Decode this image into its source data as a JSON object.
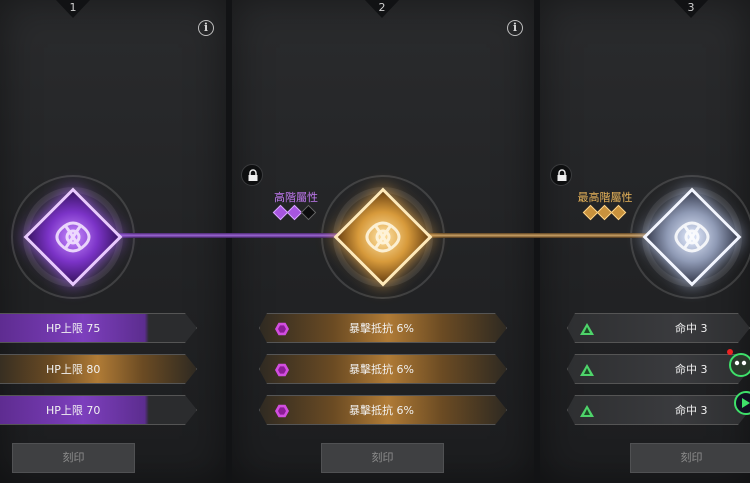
{
  "columns": [
    {
      "number": "1",
      "tier": "purple",
      "stats": [
        "HP上限 75",
        "HP上限 80",
        "HP上限 70"
      ],
      "button_label": "刻印"
    },
    {
      "number": "2",
      "tier": "gold",
      "unlock_label": "高階屬性",
      "unlock_pips": [
        "purple",
        "purple",
        "black"
      ],
      "stats": [
        "暴擊抵抗 6%",
        "暴擊抵抗 6%",
        "暴擊抵抗 6%"
      ],
      "button_label": "刻印"
    },
    {
      "number": "3",
      "tier": "silver",
      "unlock_label": "最高階屬性",
      "unlock_pips": [
        "gold",
        "gold",
        "gold"
      ],
      "stats": [
        "命中 3",
        "命中 3",
        "命中 3"
      ],
      "button_label": "刻印"
    }
  ],
  "icons": {
    "info": "info-icon",
    "lock": "lock-icon",
    "crit_resist_stat": "hexagon-icon",
    "accuracy_stat": "triangle-icon"
  },
  "colors": {
    "purple": "#7d3fbd",
    "gold": "#b07b36",
    "silver": "#8f9ab5",
    "green_icon": "#4ed46a",
    "magenta_icon": "#d24ee0"
  }
}
